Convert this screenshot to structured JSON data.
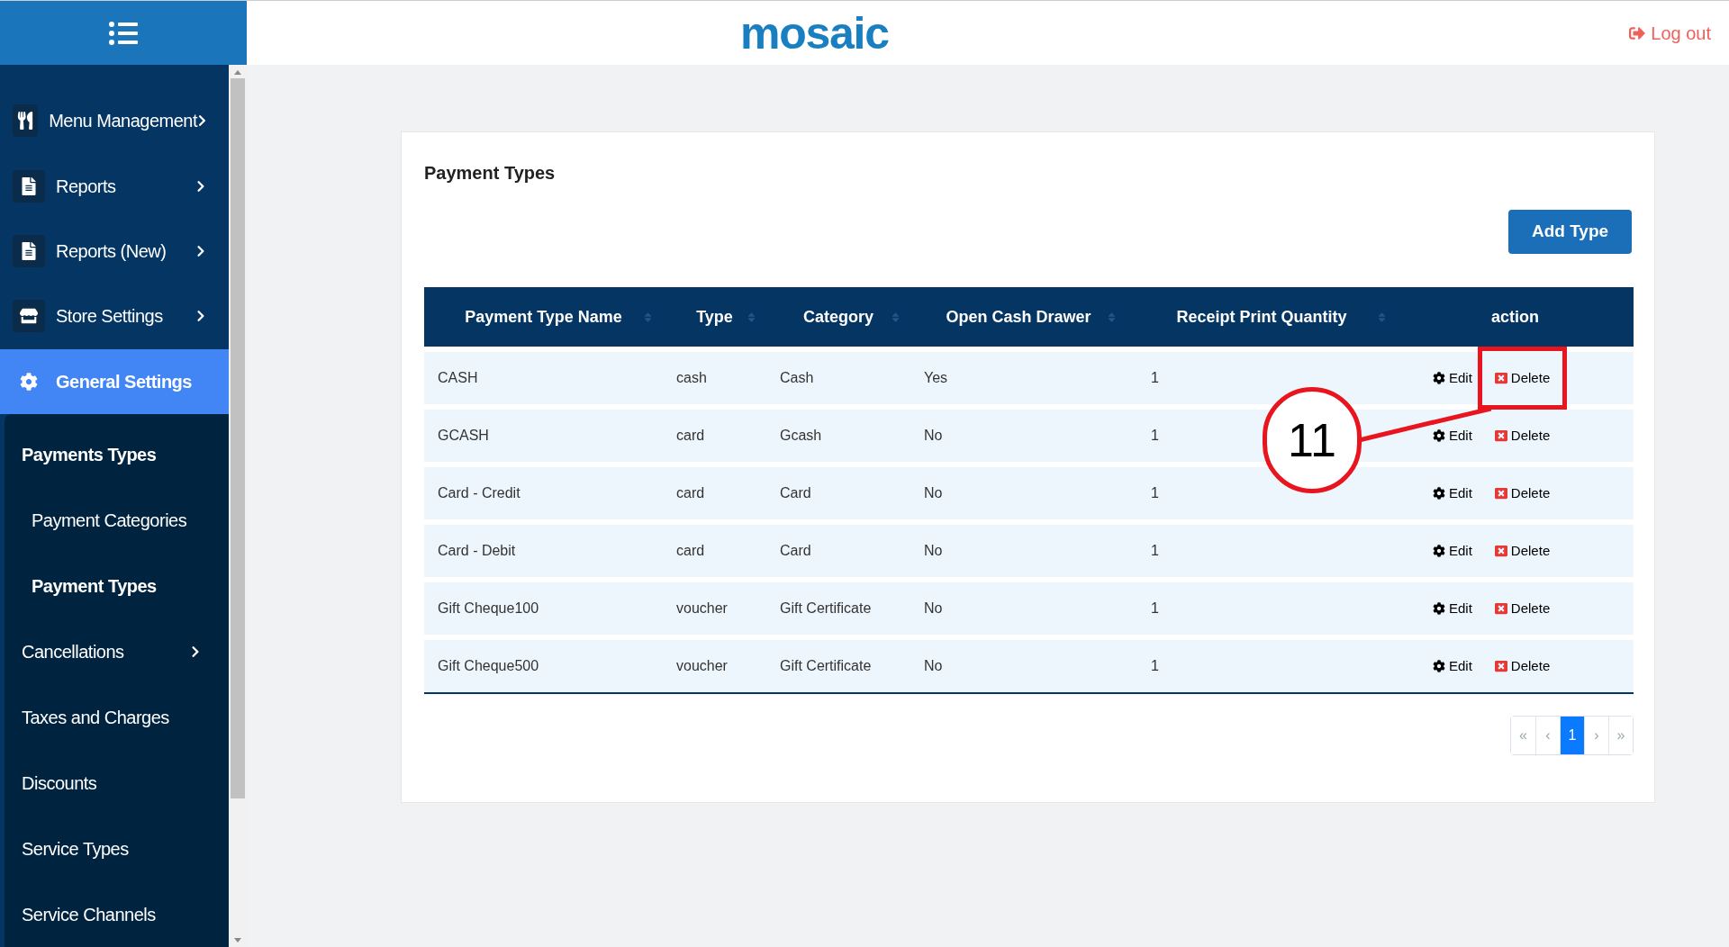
{
  "header": {
    "logo": "mosaic",
    "logout": "Log out"
  },
  "sidebar": {
    "items": [
      {
        "label": "Menu Management",
        "has_arrow": true,
        "selected": false
      },
      {
        "label": "Reports",
        "has_arrow": true,
        "selected": false
      },
      {
        "label": "Reports (New)",
        "has_arrow": true,
        "selected": false
      },
      {
        "label": "Store Settings",
        "has_arrow": true,
        "selected": false
      },
      {
        "label": "General Settings",
        "has_arrow": false,
        "selected": true
      }
    ],
    "submenu": [
      {
        "label": "Payments Types",
        "has_arrow": false,
        "expanded": true,
        "children": [
          {
            "label": "Payment Categories",
            "selected": false
          },
          {
            "label": "Payment Types",
            "selected": true
          }
        ]
      },
      {
        "label": "Cancellations",
        "has_arrow": true
      },
      {
        "label": "Taxes and Charges",
        "has_arrow": false
      },
      {
        "label": "Discounts",
        "has_arrow": false
      },
      {
        "label": "Service Types",
        "has_arrow": false
      },
      {
        "label": "Service Channels",
        "has_arrow": false
      }
    ]
  },
  "card": {
    "title": "Payment Types",
    "add_button": "Add Type"
  },
  "table": {
    "columns": [
      {
        "label": "Payment Type Name",
        "sortable": true
      },
      {
        "label": "Type",
        "sortable": true
      },
      {
        "label": "Category",
        "sortable": true
      },
      {
        "label": "Open Cash Drawer",
        "sortable": true
      },
      {
        "label": "Receipt Print Quantity",
        "sortable": true
      },
      {
        "label": "action",
        "sortable": false
      }
    ],
    "rows": [
      {
        "cells": [
          "CASH",
          "cash",
          "Cash",
          "Yes",
          "1"
        ],
        "edit": "Edit",
        "delete": "Delete",
        "highlighted": true
      },
      {
        "cells": [
          "GCASH",
          "card",
          "Gcash",
          "No",
          "1"
        ],
        "edit": "Edit",
        "delete": "Delete",
        "highlighted": false
      },
      {
        "cells": [
          "Card - Credit",
          "card",
          "Card",
          "No",
          "1"
        ],
        "edit": "Edit",
        "delete": "Delete",
        "highlighted": false
      },
      {
        "cells": [
          "Card - Debit",
          "card",
          "Card",
          "No",
          "1"
        ],
        "edit": "Edit",
        "delete": "Delete",
        "highlighted": false
      },
      {
        "cells": [
          "Gift Cheque100",
          "voucher",
          "Gift Certificate",
          "No",
          "1"
        ],
        "edit": "Edit",
        "delete": "Delete",
        "highlighted": false
      },
      {
        "cells": [
          "Gift Cheque500",
          "voucher",
          "Gift Certificate",
          "No",
          "1"
        ],
        "edit": "Edit",
        "delete": "Delete",
        "highlighted": false
      }
    ]
  },
  "pagination": [
    {
      "label": "«",
      "selected": false
    },
    {
      "label": "‹",
      "selected": false
    },
    {
      "label": "1",
      "selected": true
    },
    {
      "label": "›",
      "selected": false
    },
    {
      "label": "»",
      "selected": false
    }
  ],
  "annotation": {
    "number": "11"
  }
}
